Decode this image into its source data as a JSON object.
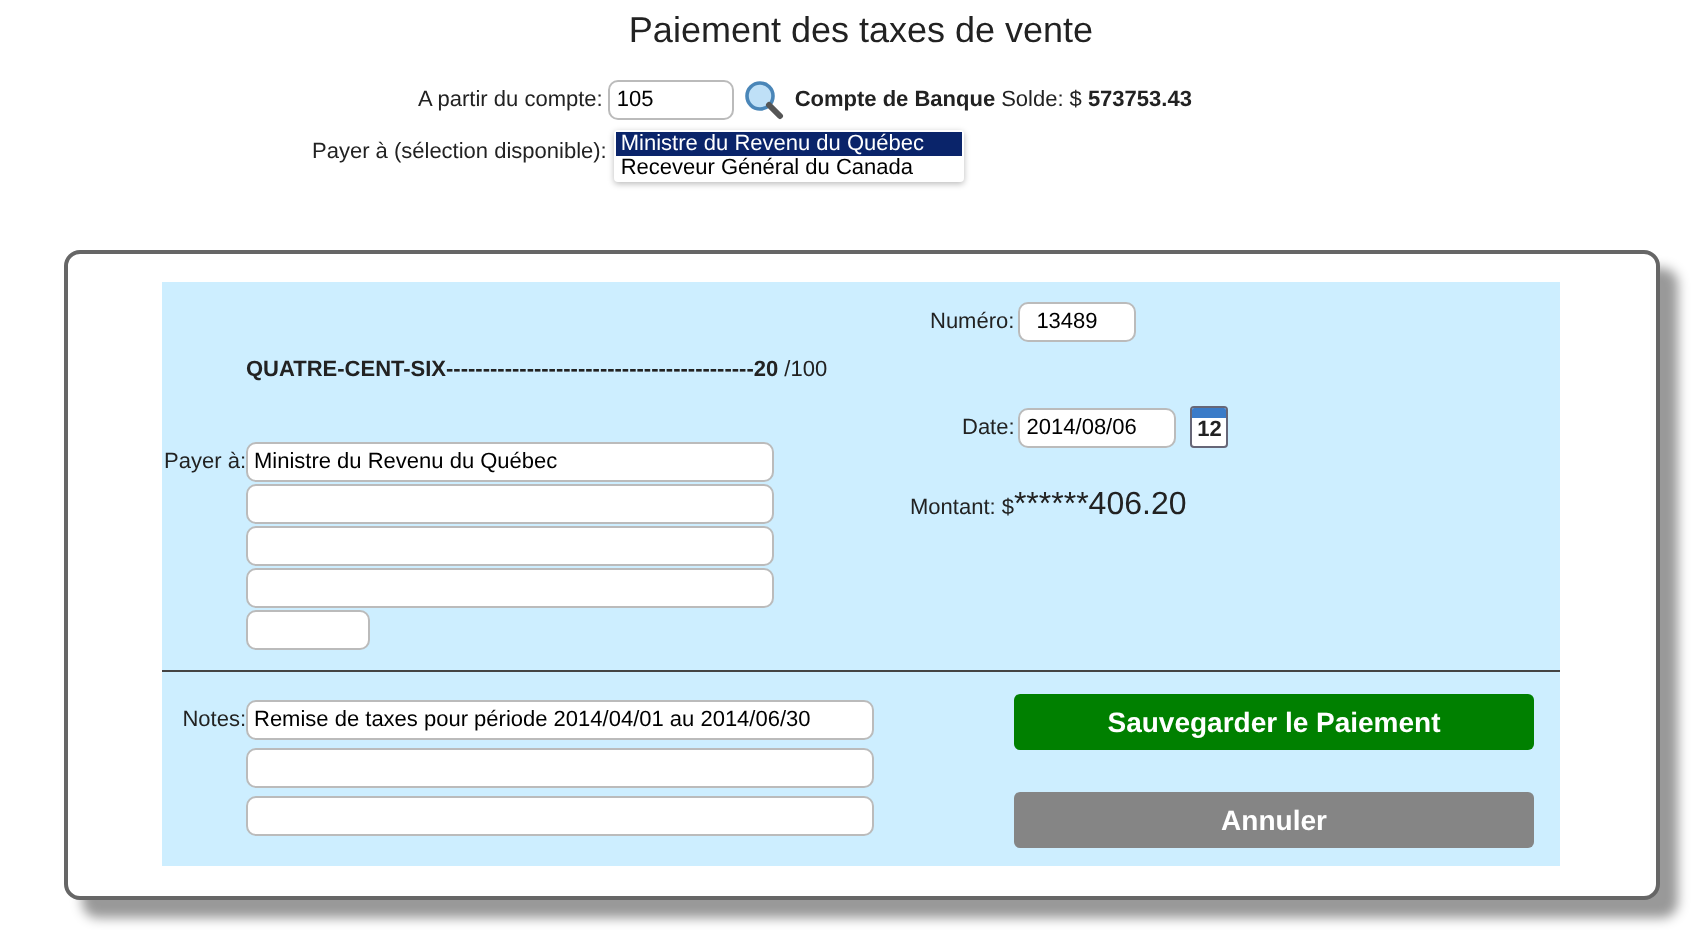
{
  "title": "Paiement des taxes de vente",
  "account": {
    "label": "A partir du compte:",
    "value": "105",
    "name": "Compte de Banque",
    "balance_label": "Solde: $",
    "balance": "573753.43"
  },
  "payee_select": {
    "label": "Payer à (sélection disponible):",
    "options": [
      {
        "label": "Ministre du Revenu du Québec",
        "selected": true
      },
      {
        "label": "Receveur Général du Canada",
        "selected": false
      }
    ]
  },
  "cheque": {
    "amount_words": "**QUATRE-CENT-SIX------------------------------------------20** /100",
    "number_label": "Numéro:",
    "number": "13489",
    "date_label": "Date:",
    "date": "2014/08/06",
    "calendar_day": "12",
    "amount_label": "Montant:",
    "amount_prefix": "$",
    "amount": "******406.20",
    "payee_label": "Payer à:",
    "payee_fields": [
      {
        "kind": "wide",
        "value": "Ministre du Revenu du Québec"
      },
      {
        "kind": "wide"
      },
      {
        "kind": "wide"
      },
      {
        "kind": "wide"
      },
      {
        "kind": "short"
      }
    ],
    "notes_label": "Notes:",
    "notes_fields": [
      {
        "kind": "wide",
        "value": "Remise de taxes pour période 2014/04/01 au 2014/06/30"
      },
      {
        "kind": "wide"
      },
      {
        "kind": "wide"
      }
    ]
  },
  "buttons": [
    {
      "label": "Sauvegarder le Paiement",
      "kind": "primary"
    },
    {
      "label": "Annuler",
      "kind": "secondary"
    }
  ]
}
